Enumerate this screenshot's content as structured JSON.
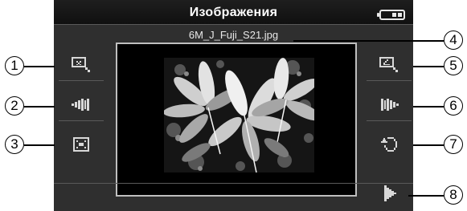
{
  "screen": {
    "title": "Изображения",
    "filename": "6M_J_Fuji_S21.jpg"
  },
  "controls": {
    "left": [
      {
        "id": 1,
        "icon": "zoom-in-icon"
      },
      {
        "id": 2,
        "icon": "previous-image-icon"
      },
      {
        "id": 3,
        "icon": "fit-screen-icon"
      }
    ],
    "right": [
      {
        "id": 5,
        "icon": "zoom-out-icon"
      },
      {
        "id": 6,
        "icon": "next-image-icon"
      },
      {
        "id": 7,
        "icon": "rotate-icon"
      },
      {
        "id": 8,
        "icon": "slideshow-play-icon"
      }
    ]
  },
  "callouts": {
    "c1": "1",
    "c2": "2",
    "c3": "3",
    "c4": "4",
    "c5": "5",
    "c6": "6",
    "c7": "7",
    "c8": "8"
  },
  "colors": {
    "screen_bg": "#2f2f2f",
    "topbar_bg": "#151515",
    "icon": "#d8d8d8",
    "viewer_bg": "#000000"
  }
}
